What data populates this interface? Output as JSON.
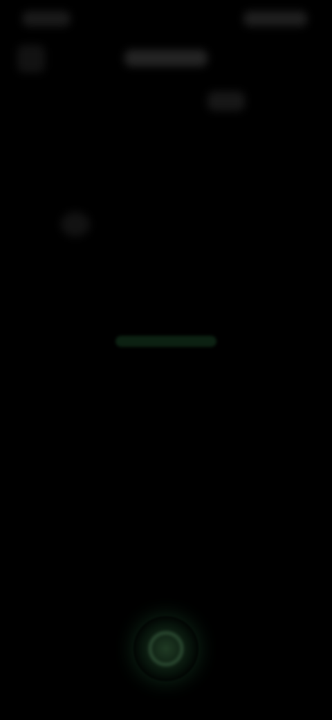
{
  "screen": {
    "hint": {
      "tag": "",
      "line1": "",
      "line2": ""
    }
  },
  "button": {
    "label": ""
  }
}
